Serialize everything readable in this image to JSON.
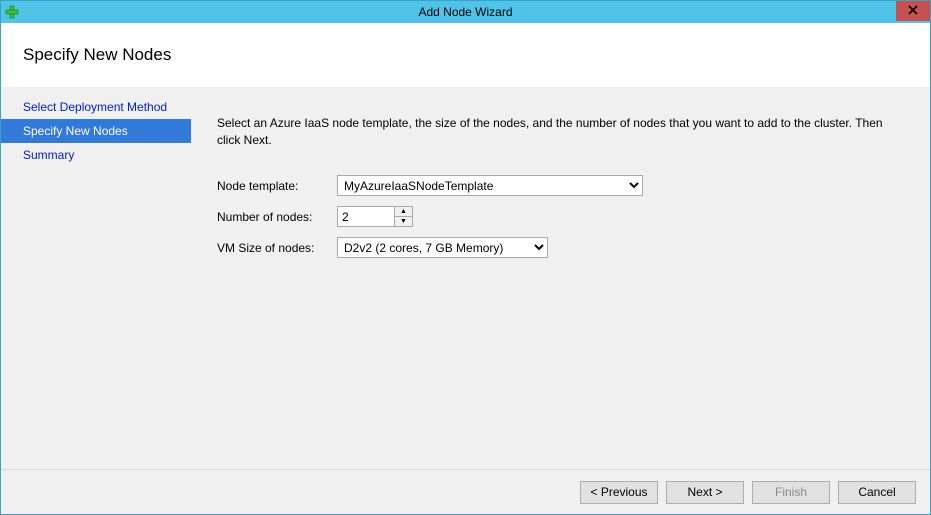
{
  "window": {
    "title": "Add Node Wizard"
  },
  "header": {
    "heading": "Specify New Nodes"
  },
  "sidebar": {
    "items": [
      {
        "label": "Select Deployment Method"
      },
      {
        "label": "Specify New Nodes"
      },
      {
        "label": "Summary"
      }
    ]
  },
  "content": {
    "instruction": "Select an Azure IaaS node template, the size of the nodes, and the number of nodes that you want to add to the cluster. Then click Next.",
    "labels": {
      "template": "Node template:",
      "count": "Number of nodes:",
      "vmsize": "VM Size of nodes:"
    },
    "values": {
      "template": "MyAzureIaaSNodeTemplate",
      "count": "2",
      "vmsize": "D2v2 (2 cores, 7 GB Memory)"
    }
  },
  "buttons": {
    "previous": "< Previous",
    "next": "Next >",
    "finish": "Finish",
    "cancel": "Cancel"
  }
}
